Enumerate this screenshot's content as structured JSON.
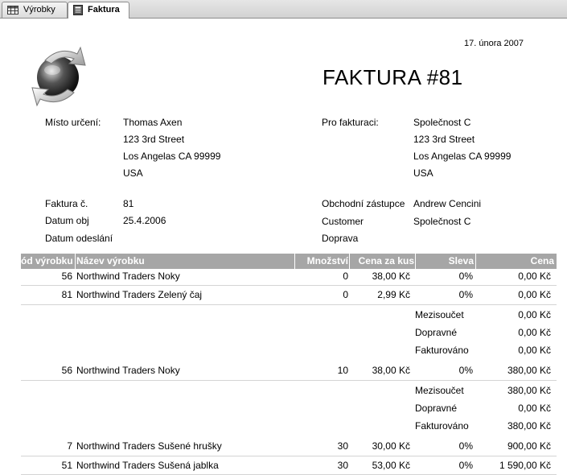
{
  "tabs": [
    {
      "label": "Výrobky",
      "icon": "table-icon",
      "active": false
    },
    {
      "label": "Faktura",
      "icon": "report-icon",
      "active": true
    }
  ],
  "report": {
    "date": "17. února 2007",
    "title": "FAKTURA #81",
    "ship_to": {
      "label": "Místo určení:",
      "lines": [
        "Thomas Axen",
        "123 3rd Street",
        "Los Angelas CA  99999",
        "USA"
      ]
    },
    "bill_to": {
      "label": "Pro fakturaci:",
      "lines": [
        "Společnost C",
        "123 3rd Street",
        "Los Angelas CA  99999",
        "USA"
      ]
    },
    "fields_left": [
      {
        "label": "Faktura č.",
        "value": "81"
      },
      {
        "label": "Datum obj",
        "value": "25.4.2006"
      },
      {
        "label": "Datum odeslání",
        "value": ""
      }
    ],
    "fields_right": [
      {
        "label": "Obchodní zástupce",
        "value": "Andrew Cencini"
      },
      {
        "label": "Customer",
        "value": "Společnost C"
      },
      {
        "label": "Doprava",
        "value": ""
      }
    ],
    "columns": [
      "ód výrobku",
      "Název výrobku",
      "Množství",
      "Cena za kus",
      "Sleva",
      "Cena"
    ],
    "rows": [
      {
        "code": "56",
        "name": "Northwind Traders Noky",
        "qty": "0",
        "unit": "38,00 Kč",
        "disc": "0%",
        "price": "0,00 Kč"
      },
      {
        "code": "81",
        "name": "Northwind Traders Zelený čaj",
        "qty": "0",
        "unit": "2,99 Kč",
        "disc": "0%",
        "price": "0,00 Kč"
      },
      {
        "code": "56",
        "name": "Northwind Traders Noky",
        "qty": "10",
        "unit": "38,00 Kč",
        "disc": "0%",
        "price": "380,00 Kč"
      },
      {
        "code": "7",
        "name": "Northwind Traders Sušené hrušky",
        "qty": "30",
        "unit": "30,00 Kč",
        "disc": "0%",
        "price": "900,00 Kč"
      },
      {
        "code": "51",
        "name": "Northwind Traders Sušená jablka",
        "qty": "30",
        "unit": "53,00 Kč",
        "disc": "0%",
        "price": "1 590,00 Kč"
      }
    ],
    "summaries": [
      [
        {
          "label": "Mezisoučet",
          "value": "0,00 Kč"
        },
        {
          "label": "Dopravné",
          "value": "0,00 Kč"
        },
        {
          "label": "Fakturováno",
          "value": "0,00 Kč"
        }
      ],
      [
        {
          "label": "Mezisoučet",
          "value": "380,00 Kč"
        },
        {
          "label": "Dopravné",
          "value": "0,00 Kč"
        },
        {
          "label": "Fakturováno",
          "value": "380,00 Kč"
        }
      ]
    ]
  }
}
